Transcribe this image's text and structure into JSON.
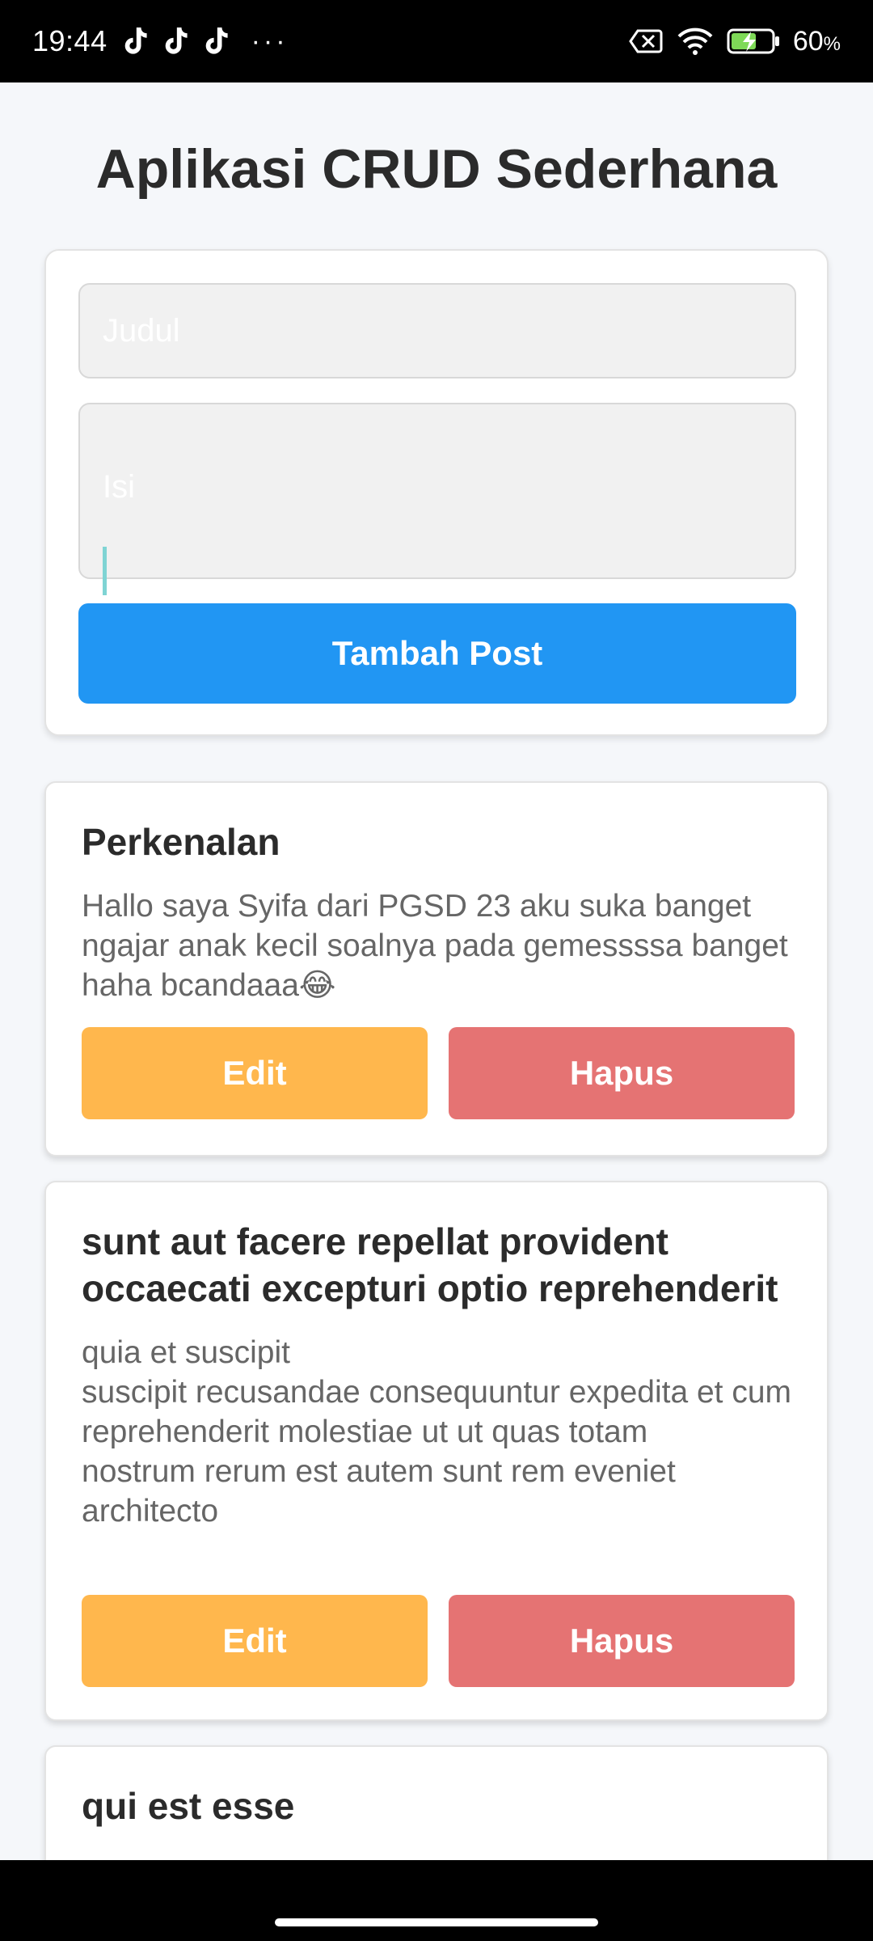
{
  "status_bar": {
    "time": "19:44",
    "notification_icons": [
      "tiktok-icon",
      "tiktok-icon",
      "tiktok-icon"
    ],
    "more": "···",
    "battery_percent": "60",
    "battery_unit": "%",
    "right_icons": [
      "no-sim-icon",
      "wifi-icon",
      "battery-charging-icon"
    ]
  },
  "app": {
    "title": "Aplikasi CRUD Sederhana",
    "form": {
      "title_placeholder": "Judul",
      "content_placeholder": "Isi",
      "submit_label": "Tambah Post"
    },
    "posts": [
      {
        "title": "Perkenalan",
        "body": "Hallo saya Syifa dari PGSD 23 aku suka banget ngajar anak kecil soalnya pada gemessssa banget haha bcandaaa😂",
        "edit_label": "Edit",
        "delete_label": "Hapus"
      },
      {
        "title": "sunt aut facere repellat provident occaecati excepturi optio reprehenderit",
        "body": "quia et suscipit\nsuscipit recusandae consequuntur expedita et cum\nreprehenderit molestiae ut ut quas totam\nnostrum rerum est autem sunt rem eveniet architecto",
        "edit_label": "Edit",
        "delete_label": "Hapus"
      },
      {
        "title": "qui est esse"
      }
    ]
  },
  "colors": {
    "primary_button": "#2196f3",
    "edit_button": "#ffb74d",
    "delete_button": "#e57373",
    "background": "#f5f7fa"
  }
}
